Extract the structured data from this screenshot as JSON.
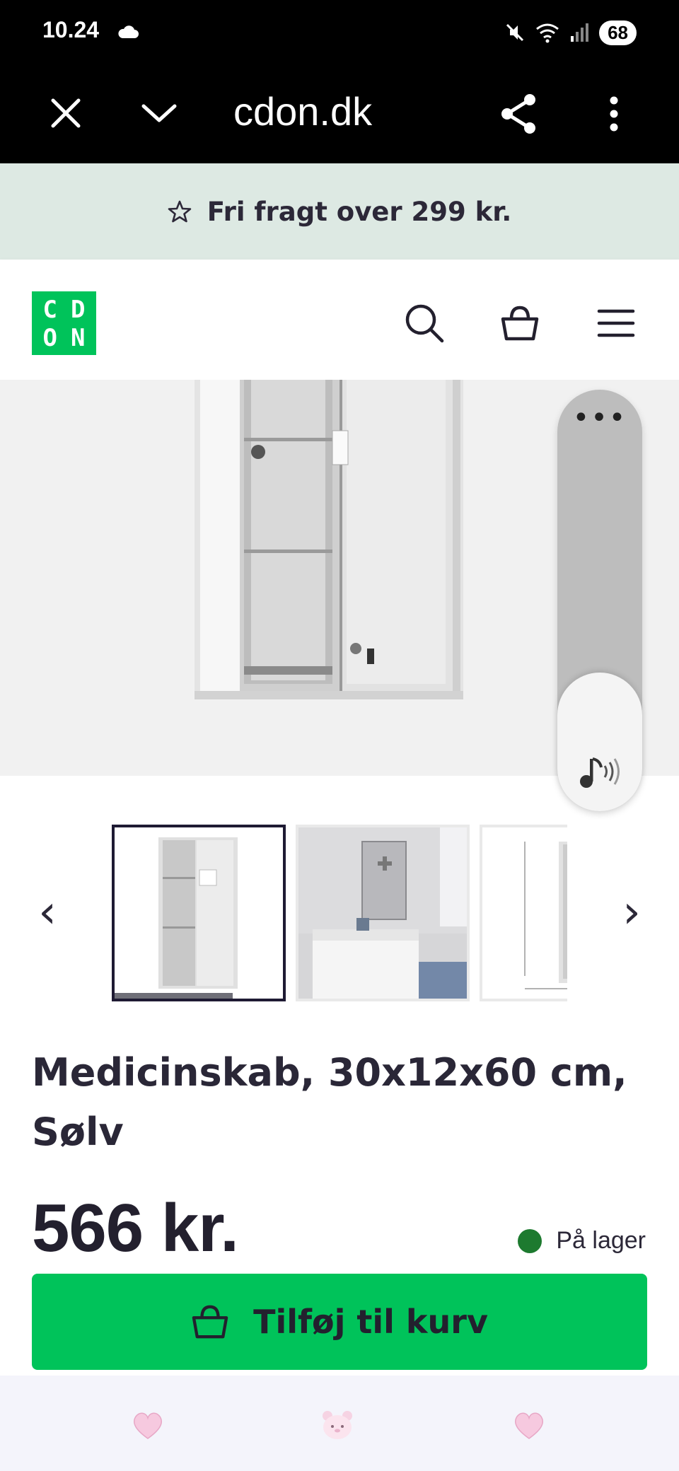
{
  "status_bar": {
    "time": "10.24",
    "battery": "68"
  },
  "browser": {
    "url": "cdon.dk"
  },
  "banner": {
    "text": "Fri fragt over 299 kr."
  },
  "header": {
    "logo_letters": [
      "C",
      "D",
      "O",
      "N"
    ]
  },
  "gallery": {
    "prev_arrow": "‹",
    "next_arrow": "›",
    "selected_index": 1,
    "thumbnail_progress": 0.7
  },
  "side_widget": {
    "menu_dots": "•••"
  },
  "product": {
    "title": "Medicinskab, 30x12x60 cm, Sølv",
    "price": "566 kr.",
    "stock_status": "På lager",
    "add_to_cart_label": "Tilføj til kurv"
  },
  "colors": {
    "brand_green": "#00c35a",
    "banner_bg": "#dde9e3",
    "stock_dot": "#1d7a2f",
    "text_dark": "#23202e"
  }
}
